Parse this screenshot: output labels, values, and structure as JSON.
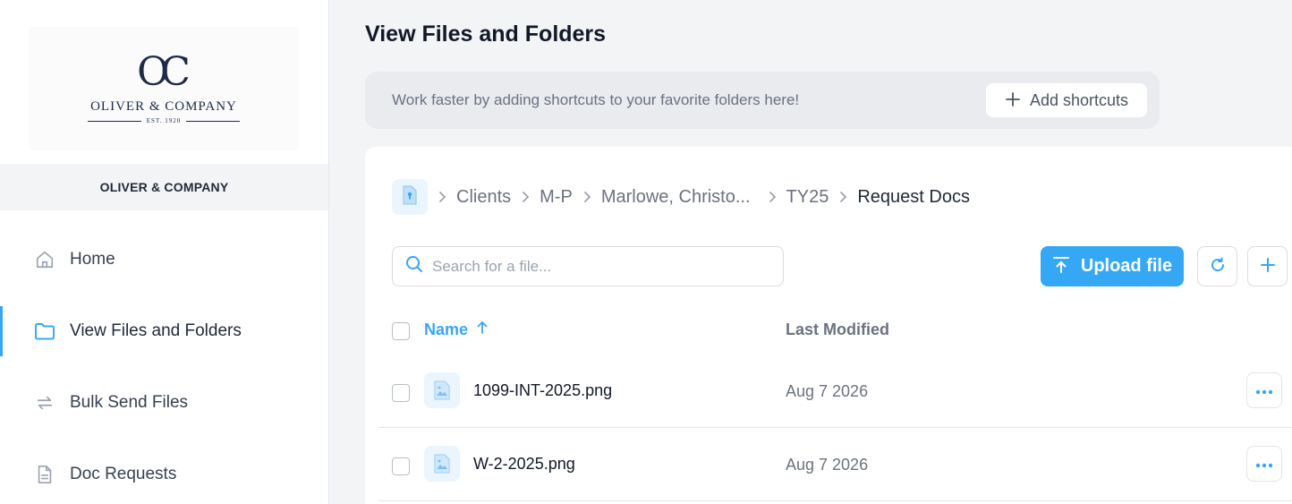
{
  "sidebar": {
    "logo": {
      "mark": "OC",
      "name": "OLIVER & COMPANY",
      "est": "EST. 1920"
    },
    "org_name": "OLIVER & COMPANY",
    "items": [
      {
        "label": "Home",
        "icon": "home-icon",
        "active": false
      },
      {
        "label": "View Files and Folders",
        "icon": "folder-icon",
        "active": true
      },
      {
        "label": "Bulk Send Files",
        "icon": "swap-arrows-icon",
        "active": false
      },
      {
        "label": "Doc Requests",
        "icon": "document-icon",
        "active": false
      }
    ]
  },
  "main": {
    "title": "View Files and Folders",
    "shortcuts": {
      "text": "Work faster by adding shortcuts to your favorite folders here!",
      "button_label": "Add shortcuts"
    },
    "breadcrumbs": [
      "Clients",
      "M-P",
      "Marlowe, Christo...",
      "TY25",
      "Request Docs"
    ],
    "search": {
      "placeholder": "Search for a file...",
      "value": ""
    },
    "toolbar": {
      "upload_label": "Upload file"
    },
    "table": {
      "columns": {
        "name": "Name",
        "modified": "Last Modified"
      },
      "sort": {
        "column": "Name",
        "direction": "ascending"
      },
      "rows": [
        {
          "name": "1099-INT-2025.png",
          "modified": "Aug 7 2026"
        },
        {
          "name": "W-2-2025.png",
          "modified": "Aug 7 2026"
        }
      ]
    }
  },
  "colors": {
    "accent": "#35a8f5",
    "sidebar_active_border": "#38a6f5",
    "main_bg": "#f3f4f6",
    "logo_navy": "#1e2a4a"
  }
}
